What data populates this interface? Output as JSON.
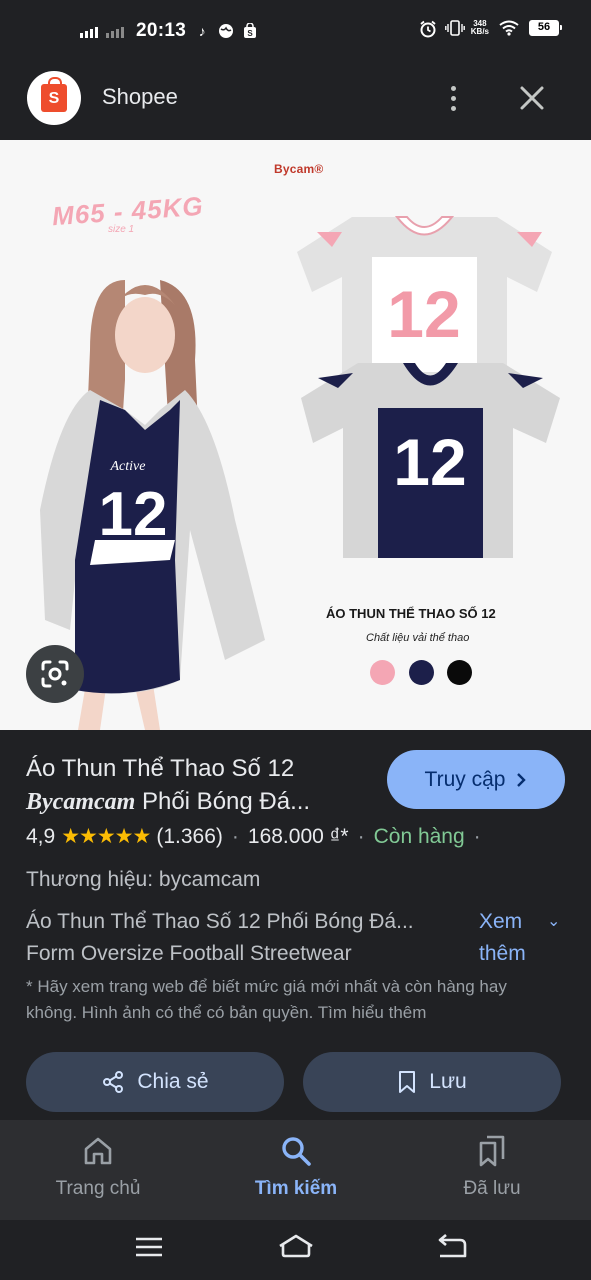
{
  "status_bar": {
    "time": "20:13",
    "net_speed_value": "348",
    "net_speed_unit": "KB/s",
    "battery": "56"
  },
  "app_header": {
    "title": "Shopee",
    "logo_letter": "S",
    "brand_color": "#ee4d2d"
  },
  "product_image": {
    "brand": "Bycam®",
    "size_text": "M65 - 45KG",
    "size_sub": "size 1",
    "shirt_title": "ÁO THUN THỂ THAO SỐ 12",
    "shirt_subtitle": "Chất liệu vải thể thao",
    "jersey_number": "12",
    "swatches": [
      "#f4a6b4",
      "#1c1f4a",
      "#0a0a0a"
    ]
  },
  "product": {
    "title_line1": "Áo Thun Thể Thao Số 12",
    "title_brand": "Bycamcam",
    "title_line2_rest": " Phối Bóng Đá...",
    "visit_label": "Truy cập",
    "rating": "4,9",
    "stars": "★★★★★",
    "review_count": "(1.366)",
    "price": "168.000 ₫*",
    "stock": "Còn hàng",
    "brand_line": "Thương hiệu: bycamcam",
    "desc_line1": "Áo Thun Thể Thao Số 12 Phối Bóng Đá...",
    "desc_line2": "Form Oversize Football Streetwear",
    "see_more": "Xem thêm",
    "disclaimer": "* Hãy xem trang web để biết mức giá mới nhất và còn hàng hay không. Hình ảnh có thể có bản quyền. Tìm hiểu thêm",
    "share_label": "Chia sẻ",
    "save_label": "Lưu"
  },
  "bottom_nav": {
    "items": [
      {
        "label": "Trang chủ",
        "icon": "home-icon"
      },
      {
        "label": "Tìm kiếm",
        "icon": "search-icon",
        "active": true
      },
      {
        "label": "Đã lưu",
        "icon": "bookmarks-icon"
      }
    ]
  },
  "system_nav": {
    "buttons": [
      "menu-icon",
      "home-icon",
      "back-icon"
    ]
  }
}
